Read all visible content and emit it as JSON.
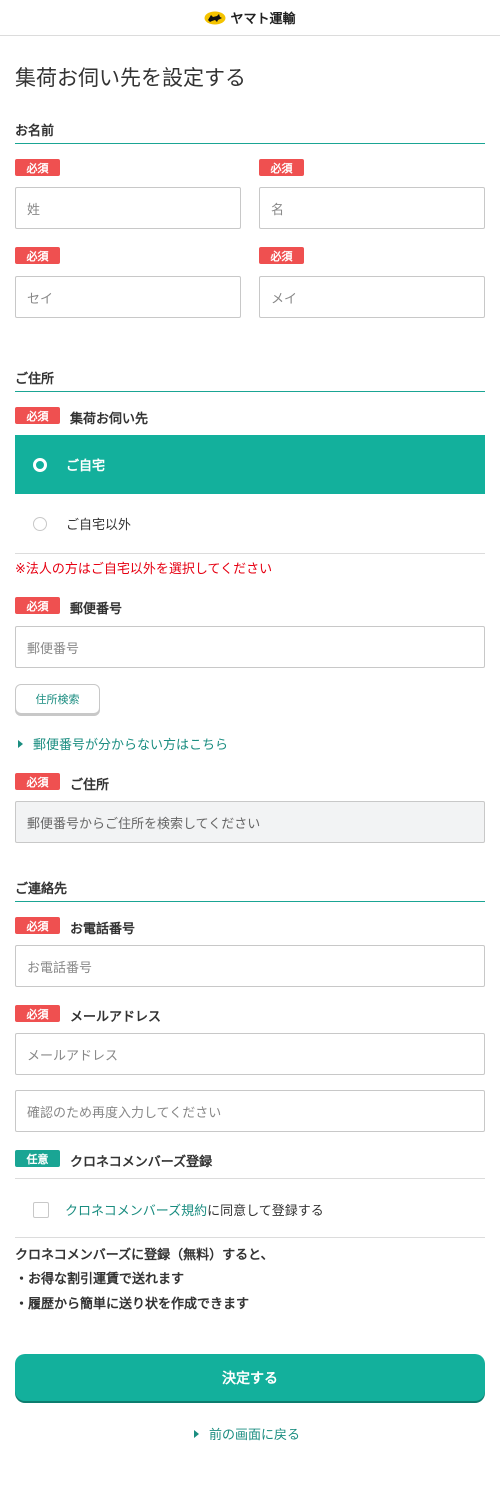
{
  "header": {
    "logo_text": "ヤマト運輸"
  },
  "page_title": "集荷お伺い先を設定する",
  "required_badge": "必須",
  "optional_badge": "任意",
  "name_section": {
    "title": "お名前",
    "last_name_placeholder": "姓",
    "first_name_placeholder": "名",
    "last_kana_placeholder": "セイ",
    "first_kana_placeholder": "メイ"
  },
  "address_section": {
    "title": "ご住所",
    "pickup_label": "集荷お伺い先",
    "options": [
      {
        "label": "ご自宅",
        "selected": true
      },
      {
        "label": "ご自宅以外",
        "selected": false
      }
    ],
    "corporate_note": "※法人の方はご自宅以外を選択してください",
    "postal_label": "郵便番号",
    "postal_placeholder": "郵便番号",
    "search_button": "住所検索",
    "unknown_postal_link": "郵便番号が分からない方はこちら",
    "address_label": "ご住所",
    "address_placeholder": "郵便番号からご住所を検索してください"
  },
  "contact_section": {
    "title": "ご連絡先",
    "phone_label": "お電話番号",
    "phone_placeholder": "お電話番号",
    "email_label": "メールアドレス",
    "email_placeholder": "メールアドレス",
    "email_confirm_placeholder": "確認のため再度入力してください",
    "members_label": "クロネコメンバーズ登録",
    "terms_link": "クロネコメンバーズ規約",
    "terms_suffix": "に同意して登録する",
    "benefits_intro": "クロネコメンバーズに登録（無料）すると、",
    "benefits": [
      "・お得な割引運賃で送れます",
      "・履歴から簡単に送り状を作成できます"
    ]
  },
  "submit_button": "決定する",
  "back_link": "前の画面に戻る",
  "colors": {
    "accent": "#13b09c",
    "required": "#ef5050",
    "link": "#1a8d80",
    "note": "#e60012"
  }
}
